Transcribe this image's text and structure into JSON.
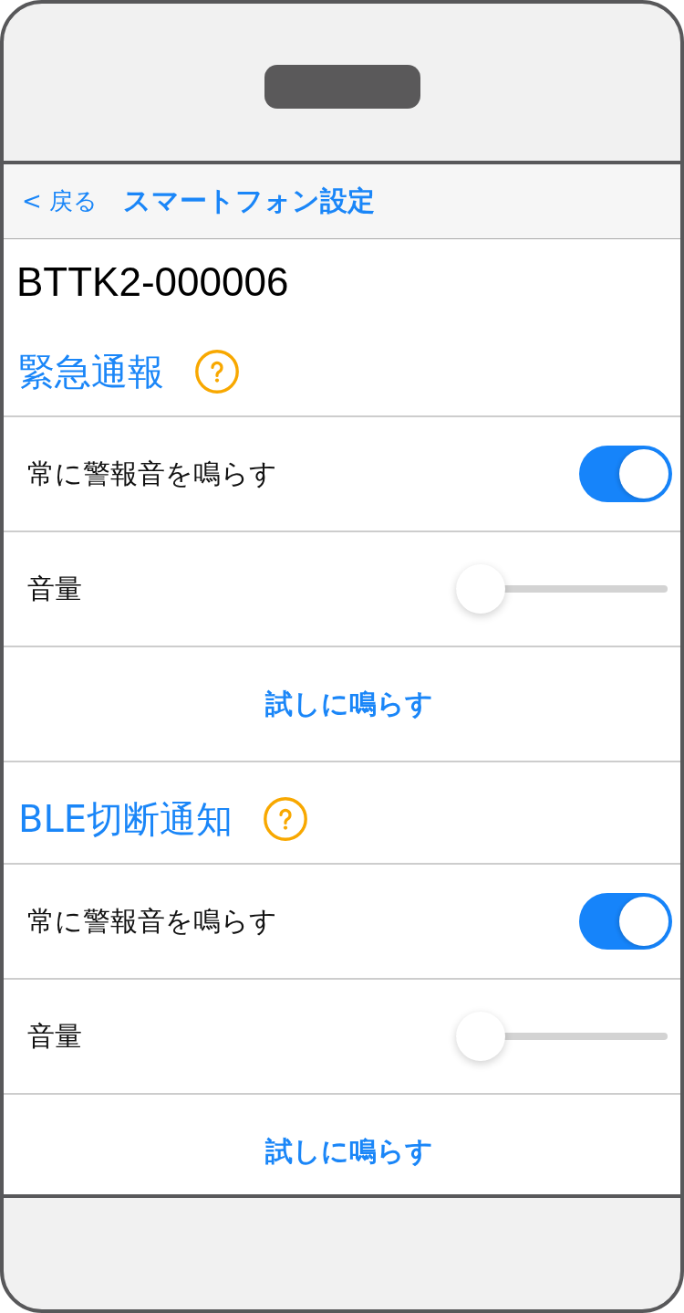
{
  "nav": {
    "back": "< 戻る",
    "title": "スマートフォン設定"
  },
  "device_name": "BTTK2-000006",
  "sections": [
    {
      "title": "緊急通報",
      "rows": [
        {
          "kind": "toggle",
          "label": "常に警報音を鳴らす",
          "on": true
        },
        {
          "kind": "slider",
          "label": "音量",
          "level": 0
        },
        {
          "kind": "button",
          "label": "試しに鳴らす"
        }
      ]
    },
    {
      "title": "BLE切断通知",
      "rows": [
        {
          "kind": "toggle",
          "label": "常に警報音を鳴らす",
          "on": true
        },
        {
          "kind": "slider",
          "label": "音量",
          "level": 0
        },
        {
          "kind": "button",
          "label": "試しに鳴らす"
        }
      ]
    }
  ]
}
